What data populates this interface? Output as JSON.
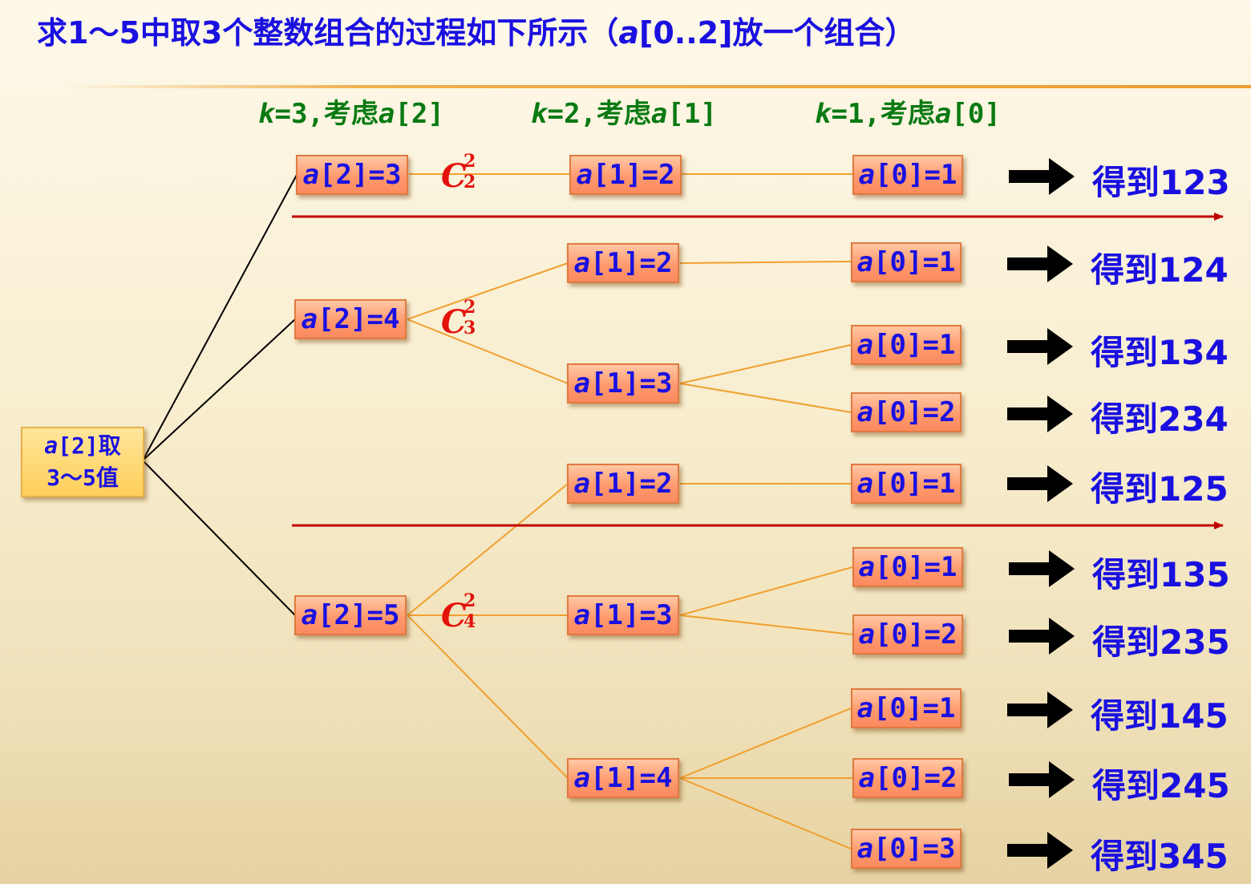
{
  "title": {
    "prefix": "求1～5中取3个整数组合的过程如下所示（",
    "var": "a",
    "range": "[0..2]",
    "suffix": "放一个组合）"
  },
  "columns": [
    {
      "k": "k",
      "eq": "=3,考虑",
      "a": "a",
      "idx": "[2]"
    },
    {
      "k": "k",
      "eq": "=2,考虑",
      "a": "a",
      "idx": "[1]"
    },
    {
      "k": "k",
      "eq": "=1,考虑",
      "a": "a",
      "idx": "[0]"
    }
  ],
  "root": {
    "var": "a",
    "line1_rest": "[2]取",
    "line2": "3～5值"
  },
  "level2": [
    {
      "var": "a",
      "text": "[2]=3"
    },
    {
      "var": "a",
      "text": "[2]=4"
    },
    {
      "var": "a",
      "text": "[2]=5"
    }
  ],
  "combos": [
    {
      "letter": "C",
      "sup": "2",
      "sub": "2"
    },
    {
      "letter": "C",
      "sup": "2",
      "sub": "3"
    },
    {
      "letter": "C",
      "sup": "2",
      "sub": "4"
    }
  ],
  "level1": [
    {
      "var": "a",
      "text": "[1]=2"
    },
    {
      "var": "a",
      "text": "[1]=2"
    },
    {
      "var": "a",
      "text": "[1]=3"
    },
    {
      "var": "a",
      "text": "[1]=2"
    },
    {
      "var": "a",
      "text": "[1]=3"
    },
    {
      "var": "a",
      "text": "[1]=4"
    }
  ],
  "level0": [
    {
      "var": "a",
      "text": "[0]=1"
    },
    {
      "var": "a",
      "text": "[0]=1"
    },
    {
      "var": "a",
      "text": "[0]=1"
    },
    {
      "var": "a",
      "text": "[0]=2"
    },
    {
      "var": "a",
      "text": "[0]=1"
    },
    {
      "var": "a",
      "text": "[0]=1"
    },
    {
      "var": "a",
      "text": "[0]=2"
    },
    {
      "var": "a",
      "text": "[0]=1"
    },
    {
      "var": "a",
      "text": "[0]=2"
    },
    {
      "var": "a",
      "text": "[0]=3"
    }
  ],
  "results": [
    "得到123",
    "得到124",
    "得到134",
    "得到234",
    "得到125",
    "得到135",
    "得到235",
    "得到145",
    "得到245",
    "得到345"
  ],
  "colors": {
    "title": "#1a10e0",
    "column_header": "#0a7a12",
    "combination": "#e3120b",
    "tree_black": "#000000",
    "tree_orange": "#f0a030",
    "separator": "#c00000",
    "arrow": "#000000"
  }
}
